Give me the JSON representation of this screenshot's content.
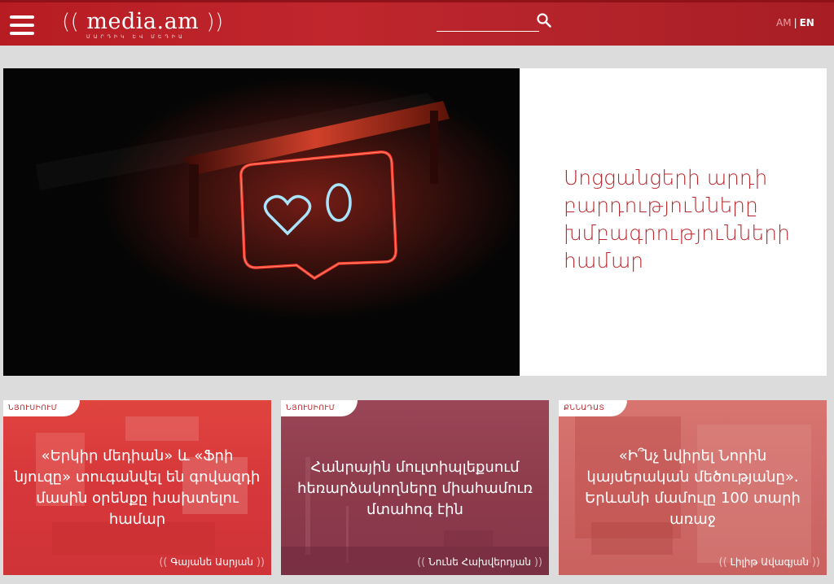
{
  "header": {
    "logo_text": "media.am",
    "logo_tagline": "ՄԱՐԴԻԿ ԵՎ ՄԵԴԻԱ",
    "search": {
      "value": "",
      "placeholder": ""
    },
    "lang_am": "AM",
    "lang_sep": "|",
    "lang_en": "EN"
  },
  "hero": {
    "title": "Սոցցանցերի արդի բարդությունները խմբագրությունների համար",
    "image_icon": "neon-like-sign"
  },
  "cards": [
    {
      "category": "ՆՅՈՒՍԻՈՒՄ",
      "title": "«Երկիր մեդիան» և «Ֆրի նյուզը» տուգանվել են գովազդի մասին օրենքը խախտելու համար",
      "author": "Գայանե Ասրյան",
      "color": "#d8383c"
    },
    {
      "category": "ՆՅՈՒՍԻՈՒՄ",
      "title": "Հանրային մուլտիպլեքսում հեռարձակողները միահամուռ մտահոգ էին",
      "author": "Նունե Հախվերդյան",
      "color": "#8e3a4c"
    },
    {
      "category": "ՔՆՆԱԴԱՏ",
      "title": "«Ի՞նչ նվիրել Նորին կայսերական մեծությանը». Երևանի մամուլը 100 տարի առաջ",
      "author": "Լիլիթ Ավագյան",
      "color": "#d06a6c"
    }
  ],
  "colors": {
    "brand": "#b9242b",
    "background": "#dcdcdc"
  }
}
